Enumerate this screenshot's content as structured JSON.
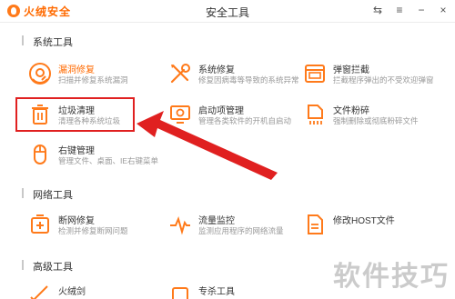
{
  "window": {
    "brand": "火绒安全",
    "title": "安全工具",
    "controls": {
      "back": "⇆",
      "menu": "≡",
      "minimize": "−",
      "close": "×"
    }
  },
  "sections": [
    {
      "label": "系统工具",
      "tools": [
        {
          "name": "漏洞修复",
          "desc": "扫描并修复系统漏洞",
          "icon": "shield-repair-icon"
        },
        {
          "name": "系统修复",
          "desc": "修复因病毒等导致的系统异常",
          "icon": "wrench-screwdriver-icon"
        },
        {
          "name": "弹窗拦截",
          "desc": "拦截程序弹出的不受欢迎弹窗",
          "icon": "popup-block-icon"
        },
        {
          "name": "垃圾清理",
          "desc": "清理各种系统垃圾",
          "icon": "trash-icon"
        },
        {
          "name": "启动项管理",
          "desc": "管理各类软件的开机自启动",
          "icon": "monitor-startup-icon"
        },
        {
          "name": "文件粉碎",
          "desc": "强制删除或彻底粉碎文件",
          "icon": "file-shred-icon"
        },
        {
          "name": "右键管理",
          "desc": "管理文件、桌面、IE右键菜单",
          "icon": "mouse-icon"
        }
      ]
    },
    {
      "label": "网络工具",
      "tools": [
        {
          "name": "断网修复",
          "desc": "检测并修复断网问题",
          "icon": "network-plus-icon"
        },
        {
          "name": "流量监控",
          "desc": "监测应用程序的网络流量",
          "icon": "pulse-icon"
        },
        {
          "name": "修改HOST文件",
          "desc": "",
          "icon": "host-file-icon"
        }
      ]
    },
    {
      "label": "高级工具",
      "tools": [
        {
          "name": "火绒剑",
          "desc": "",
          "icon": "sword-icon"
        },
        {
          "name": "专杀工具",
          "desc": "",
          "icon": "kill-tool-icon"
        }
      ]
    }
  ],
  "watermark": "软件技巧",
  "colors": {
    "accent": "#ff7a1a",
    "highlight": "#e02020",
    "arrow": "#e02020"
  }
}
